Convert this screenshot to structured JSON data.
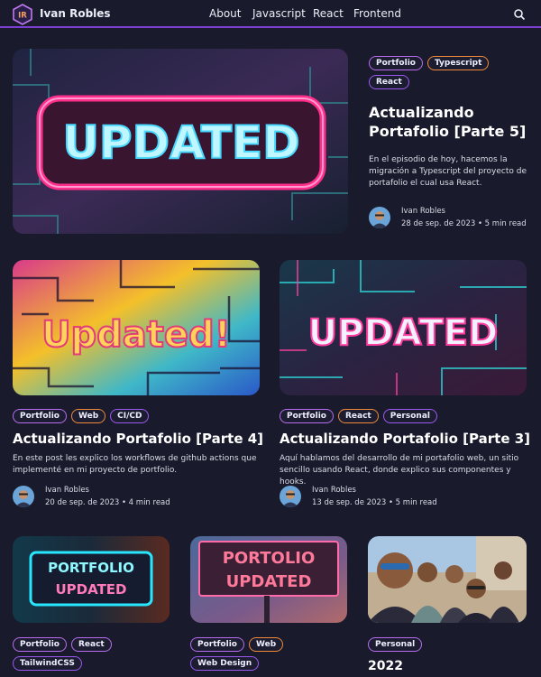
{
  "nav": {
    "brand": "Ivan Robles",
    "logo_text": "IR",
    "links": [
      "About",
      "Javascript",
      "React",
      "Frontend"
    ],
    "search_icon": "search-icon"
  },
  "featured": {
    "image_text": "UPDATED",
    "tags": [
      "Portfolio",
      "Typescript",
      "React"
    ],
    "title": "Actualizando Portafolio [Parte 5]",
    "excerpt": "En el episodio de hoy, hacemos la migración a Typescript del proyecto de portafolio el cual usa React.",
    "author": "Ivan Robles",
    "meta": "28 de sep. de 2023 • 5 min read"
  },
  "posts": [
    {
      "image_text": "Updated!",
      "tags": [
        "Portfolio",
        "Web",
        "CI/CD"
      ],
      "title": "Actualizando Portafolio [Parte 4]",
      "excerpt": "En este post les explico los workflows de github actions que implementé en mi proyecto de portfolio.",
      "author": "Ivan Robles",
      "meta": "20 de sep. de 2023 • 4 min read"
    },
    {
      "image_text": "UPDATED",
      "tags": [
        "Portfolio",
        "React",
        "Personal"
      ],
      "title": "Actualizando Portafolio [Parte 3]",
      "excerpt": "Aquí hablamos del desarrollo de mi portafolio web, un sitio sencillo usando React, donde explico sus componentes y hooks.",
      "author": "Ivan Robles",
      "meta": "13 de sep. de 2023 • 5 min read"
    }
  ],
  "small_posts": [
    {
      "image_lines": [
        "PORTFOLIO",
        "UPDATED"
      ],
      "tags": [
        "Portfolio",
        "React",
        "TailwindCSS"
      ]
    },
    {
      "image_lines": [
        "PORTOLIO",
        "UPDATED"
      ],
      "tags": [
        "Portfolio",
        "Web",
        "Web Design"
      ]
    },
    {
      "tags": [
        "Personal"
      ],
      "title": "2022"
    }
  ],
  "colors": {
    "background": "#191a2b",
    "accent": "#7a3fd0",
    "tag_purple": "#b86df0",
    "tag_orange": "#f08a3a"
  }
}
